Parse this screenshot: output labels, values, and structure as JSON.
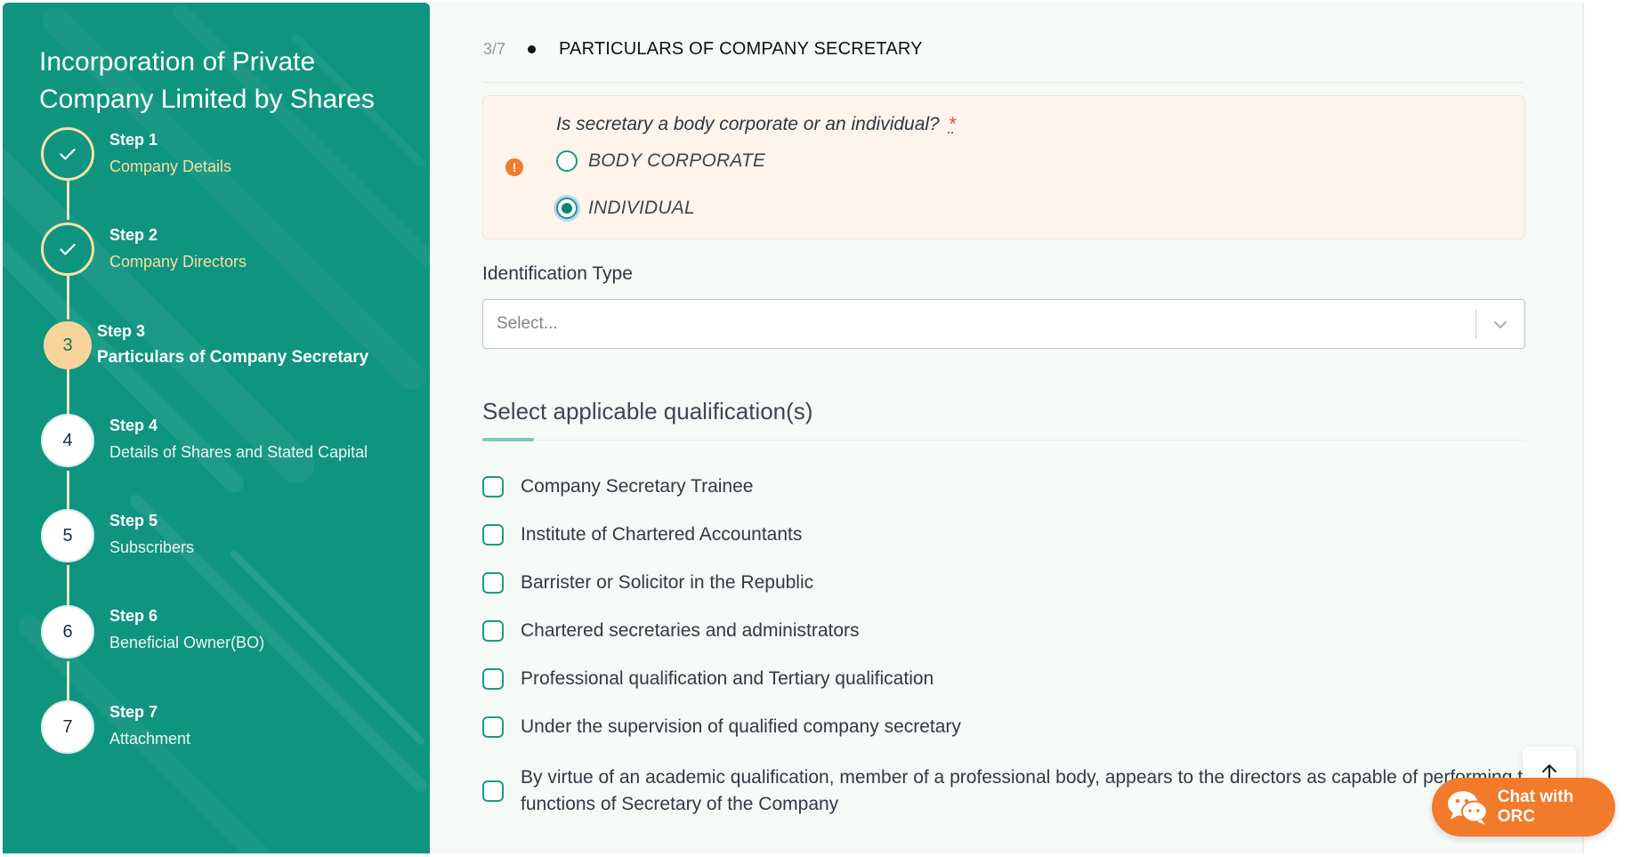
{
  "sidebar": {
    "title": "Incorporation of Private Company Limited by Shares",
    "steps": [
      {
        "title": "Step 1",
        "name": "Company Details",
        "number": "",
        "status": "done"
      },
      {
        "title": "Step 2",
        "name": "Company Directors",
        "number": "",
        "status": "done"
      },
      {
        "title": "Step 3",
        "name": "Particulars of Company Secretary",
        "number": "3",
        "status": "active"
      },
      {
        "title": "Step 4",
        "name": "Details of Shares and Stated Capital",
        "number": "4",
        "status": "todo"
      },
      {
        "title": "Step 5",
        "name": "Subscribers",
        "number": "5",
        "status": "todo"
      },
      {
        "title": "Step 6",
        "name": "Beneficial Owner(BO)",
        "number": "6",
        "status": "todo"
      },
      {
        "title": "Step 7",
        "name": "Attachment",
        "number": "7",
        "status": "todo"
      }
    ]
  },
  "header": {
    "step_count": "3/7",
    "section_title": "PARTICULARS OF COMPANY SECRETARY"
  },
  "question": {
    "text": "Is secretary a body corporate or an individual?",
    "required_marker": "*",
    "options": [
      {
        "label": "BODY CORPORATE",
        "selected": false
      },
      {
        "label": "INDIVIDUAL",
        "selected": true
      }
    ]
  },
  "identification": {
    "label": "Identification Type",
    "placeholder": "Select..."
  },
  "qualifications": {
    "heading": "Select applicable qualification(s)",
    "items": [
      "Company Secretary Trainee",
      "Institute of Chartered Accountants",
      "Barrister or Solicitor in the Republic",
      "Chartered secretaries and administrators",
      "Professional qualification and Tertiary qualification",
      "Under the supervision of qualified company secretary",
      "By virtue of an academic qualification, member of a professional body, appears to the directors as capable of performing the functions of Secretary of the Company"
    ]
  },
  "chat": {
    "label": "Chat with ORC"
  },
  "colors": {
    "sidebar": "#0f9480",
    "accent": "#1a9b84",
    "warning": "#f07d2a",
    "chat": "#f27a2b",
    "active_step": "#f9d49a"
  }
}
